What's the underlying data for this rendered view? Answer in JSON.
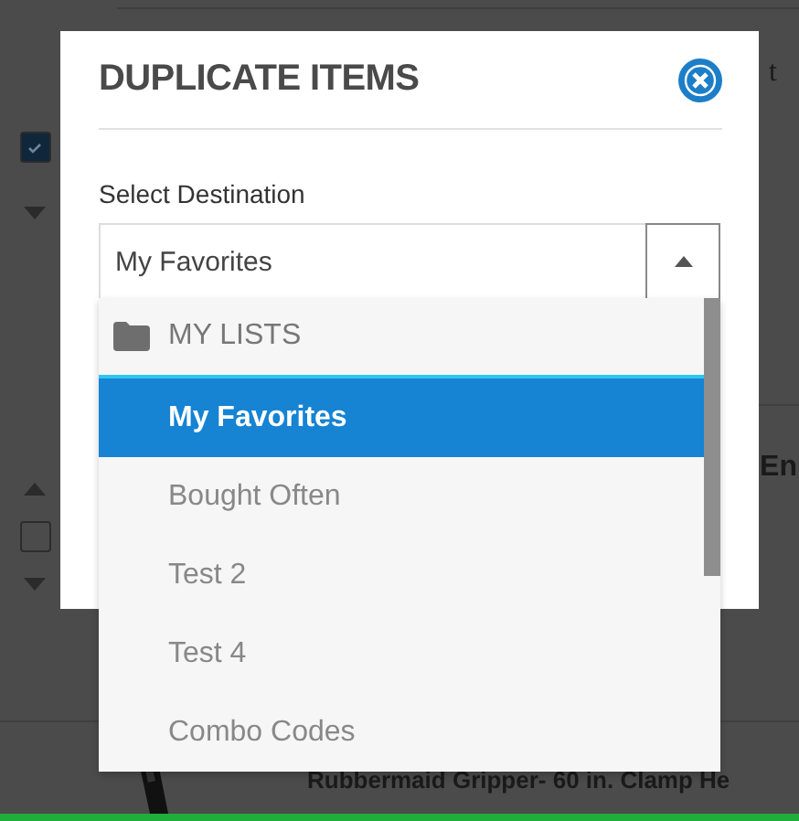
{
  "background": {
    "rows": [
      {
        "checked": true,
        "side_text": "t"
      },
      {
        "checked": false,
        "side_text": "En"
      },
      {
        "product_text": "Rubbermaid Gripper- 60 in. Clamp He"
      }
    ]
  },
  "dialog": {
    "title": "DUPLICATE ITEMS",
    "field_label": "Select Destination",
    "select": {
      "value": "My Favorites",
      "expanded": true
    },
    "options": [
      {
        "kind": "group",
        "label": "MY LISTS"
      },
      {
        "kind": "option",
        "label": "My Favorites",
        "selected": true
      },
      {
        "kind": "option",
        "label": "Bought Often",
        "selected": false
      },
      {
        "kind": "option",
        "label": "Test 2",
        "selected": false
      },
      {
        "kind": "option",
        "label": "Test 4",
        "selected": false
      },
      {
        "kind": "option",
        "label": "Combo Codes",
        "selected": false
      }
    ]
  }
}
